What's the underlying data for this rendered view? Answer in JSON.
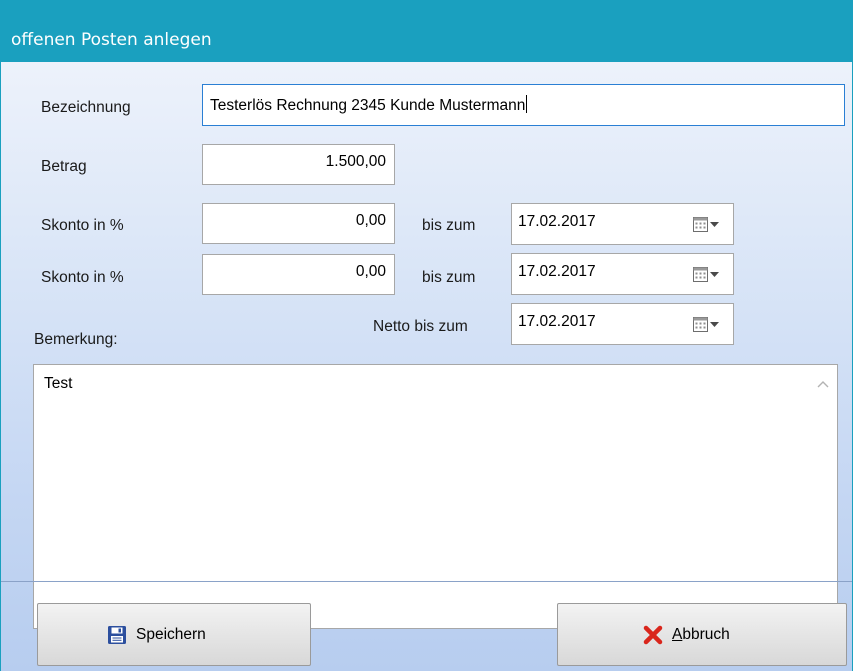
{
  "window": {
    "title": "offenen Posten anlegen"
  },
  "form": {
    "bezeichnung_label": "Bezeichnung",
    "bezeichnung_value": "Testerlös Rechnung 2345 Kunde Mustermann",
    "betrag_label": "Betrag",
    "betrag_value": "1.500,00",
    "skonto1_label": "Skonto in %",
    "skonto1_value": "0,00",
    "skonto1_date_label": "bis zum",
    "skonto1_date": "17.02.2017",
    "skonto2_label": "Skonto in %",
    "skonto2_value": "0,00",
    "skonto2_date_label": "bis zum",
    "skonto2_date": "17.02.2017",
    "netto_label": "Netto bis zum",
    "netto_date": "17.02.2017",
    "bemerkung_label": "Bemerkung:",
    "bemerkung_value": "Test"
  },
  "buttons": {
    "save_label": "Speichern",
    "cancel_label_underlined": "A",
    "cancel_label_rest": "bbruch"
  },
  "icons": {
    "save": "floppy-disk-icon",
    "cancel": "red-x-icon",
    "calendar": "calendar-dropdown-icon"
  },
  "colors": {
    "titlebar": "#1aa0bf",
    "cancel_icon": "#d9261c",
    "save_icon": "#2c4f9e"
  }
}
